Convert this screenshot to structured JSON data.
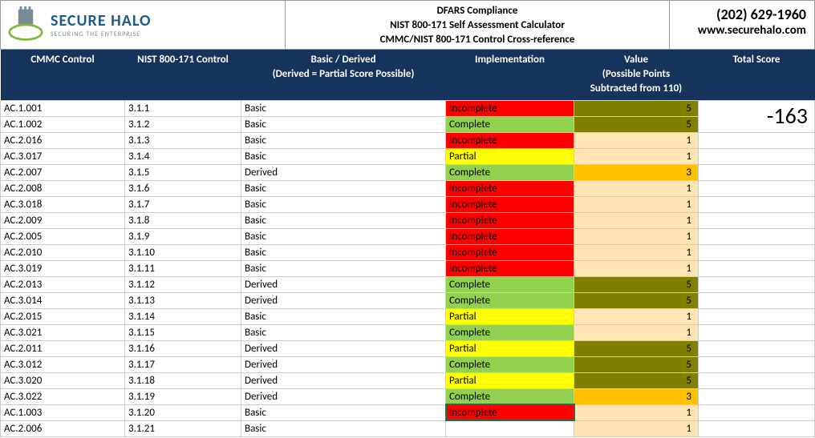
{
  "header": {
    "logo_title": "SECURE HALO",
    "logo_sub": "SECURING THE ENTERPRISE",
    "title_line1": "DFARS Compliance",
    "title_line2": "NIST 800-171 Self Assessment Calculator",
    "title_line3": "CMMC/NIST 800-171 Control Cross-reference",
    "phone": "(202) 629-1960",
    "url": "www.securehalo.com"
  },
  "columns": {
    "cmmc": "CMMC Control",
    "nist": "NIST 800-171 Control",
    "basic": "Basic / Derived\n(Derived = Partial Score Possible)",
    "impl": "Implementation",
    "value": "Value\n(Possible Points\nSubtracted from 110)",
    "score": "Total Score"
  },
  "total_score": "-163",
  "rows": [
    {
      "cmmc": "AC.1.001",
      "nist": "3.1.1",
      "basic": "Basic",
      "impl": "Incomplete",
      "impl_class": "impl-incomplete",
      "value": "5",
      "val_class": "val-olive"
    },
    {
      "cmmc": "AC.1.002",
      "nist": "3.1.2",
      "basic": "Basic",
      "impl": "Complete",
      "impl_class": "impl-complete",
      "value": "5",
      "val_class": "val-olive"
    },
    {
      "cmmc": "AC.2.016",
      "nist": "3.1.3",
      "basic": "Basic",
      "impl": "Incomplete",
      "impl_class": "impl-incomplete",
      "value": "1",
      "val_class": "val-cream"
    },
    {
      "cmmc": "AC.3.017",
      "nist": "3.1.4",
      "basic": "Basic",
      "impl": "Partial",
      "impl_class": "impl-partial",
      "value": "1",
      "val_class": "val-cream"
    },
    {
      "cmmc": "AC.2.007",
      "nist": "3.1.5",
      "basic": "Derived",
      "impl": "Complete",
      "impl_class": "impl-complete",
      "value": "3",
      "val_class": "val-orange"
    },
    {
      "cmmc": "AC.2.008",
      "nist": "3.1.6",
      "basic": "Basic",
      "impl": "Incomplete",
      "impl_class": "impl-incomplete",
      "value": "1",
      "val_class": "val-cream"
    },
    {
      "cmmc": "AC.3.018",
      "nist": "3.1.7",
      "basic": "Basic",
      "impl": "Incomplete",
      "impl_class": "impl-incomplete",
      "value": "1",
      "val_class": "val-cream"
    },
    {
      "cmmc": "AC.2.009",
      "nist": "3.1.8",
      "basic": "Basic",
      "impl": "Incomplete",
      "impl_class": "impl-incomplete",
      "value": "1",
      "val_class": "val-cream"
    },
    {
      "cmmc": "AC.2.005",
      "nist": "3.1.9",
      "basic": "Basic",
      "impl": "Incomplete",
      "impl_class": "impl-incomplete",
      "value": "1",
      "val_class": "val-cream"
    },
    {
      "cmmc": "AC.2.010",
      "nist": "3.1.10",
      "basic": "Basic",
      "impl": "Incomplete",
      "impl_class": "impl-incomplete",
      "value": "1",
      "val_class": "val-cream"
    },
    {
      "cmmc": "AC.3.019",
      "nist": "3.1.11",
      "basic": "Basic",
      "impl": "Incomplete",
      "impl_class": "impl-incomplete",
      "value": "1",
      "val_class": "val-cream"
    },
    {
      "cmmc": "AC.2.013",
      "nist": "3.1.12",
      "basic": "Derived",
      "impl": "Complete",
      "impl_class": "impl-complete",
      "value": "5",
      "val_class": "val-olive"
    },
    {
      "cmmc": "AC.3.014",
      "nist": "3.1.13",
      "basic": "Derived",
      "impl": "Complete",
      "impl_class": "impl-complete",
      "value": "5",
      "val_class": "val-olive"
    },
    {
      "cmmc": "AC.2.015",
      "nist": "3.1.14",
      "basic": "Basic",
      "impl": "Partial",
      "impl_class": "impl-partial",
      "value": "1",
      "val_class": "val-cream"
    },
    {
      "cmmc": "AC.3.021",
      "nist": "3.1.15",
      "basic": "Basic",
      "impl": "Complete",
      "impl_class": "impl-complete",
      "value": "1",
      "val_class": "val-cream"
    },
    {
      "cmmc": "AC.2.011",
      "nist": "3.1.16",
      "basic": "Derived",
      "impl": "Partial",
      "impl_class": "impl-partial",
      "value": "5",
      "val_class": "val-olive"
    },
    {
      "cmmc": "AC.3.012",
      "nist": "3.1.17",
      "basic": "Derived",
      "impl": "Complete",
      "impl_class": "impl-complete",
      "value": "5",
      "val_class": "val-olive"
    },
    {
      "cmmc": "AC.3.020",
      "nist": "3.1.18",
      "basic": "Derived",
      "impl": "Partial",
      "impl_class": "impl-partial",
      "value": "5",
      "val_class": "val-olive"
    },
    {
      "cmmc": "AC.3.022",
      "nist": "3.1.19",
      "basic": "Derived",
      "impl": "Complete",
      "impl_class": "impl-complete",
      "value": "3",
      "val_class": "val-orange"
    },
    {
      "cmmc": "AC.1.003",
      "nist": "3.1.20",
      "basic": "Basic",
      "impl": "Incomplete",
      "impl_class": "impl-incomplete",
      "value": "1",
      "val_class": "val-cream",
      "selected": true
    },
    {
      "cmmc": "AC.2.006",
      "nist": "3.1.21",
      "basic": "Basic",
      "impl": "",
      "impl_class": "",
      "value": "1",
      "val_class": "val-cream"
    }
  ]
}
